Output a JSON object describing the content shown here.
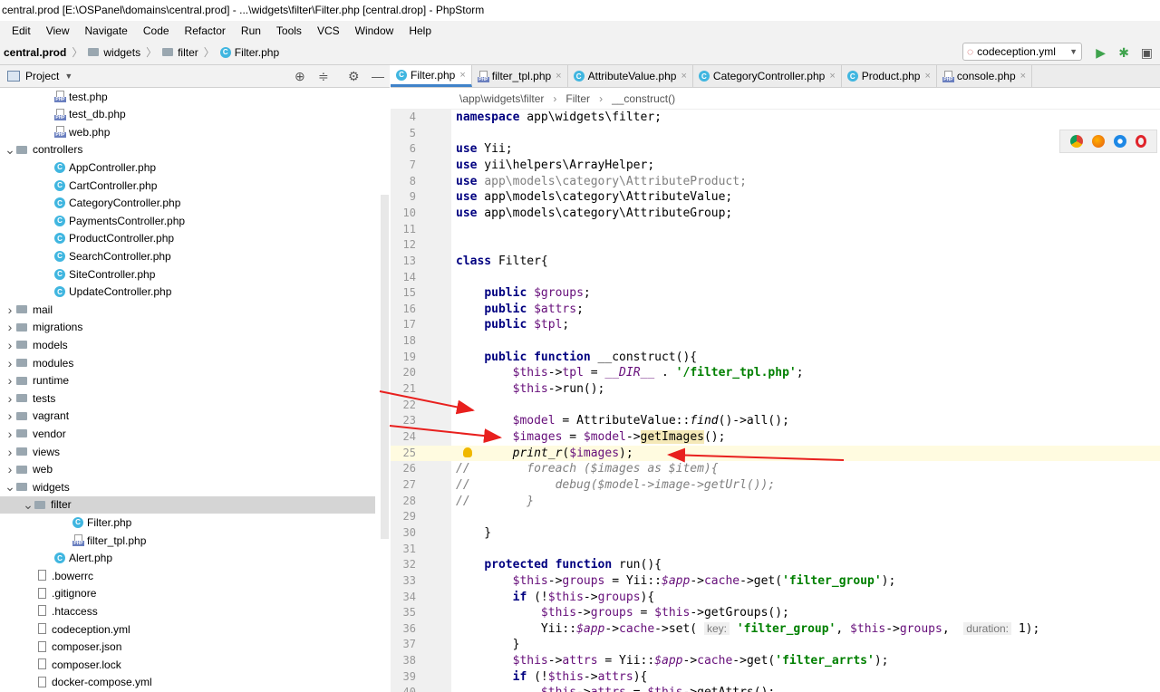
{
  "window": {
    "title": "central.prod [E:\\OSPanel\\domains\\central.prod] - ...\\widgets\\filter\\Filter.php [central.drop] - PhpStorm"
  },
  "menu": [
    "Edit",
    "View",
    "Navigate",
    "Code",
    "Refactor",
    "Run",
    "Tools",
    "VCS",
    "Window",
    "Help"
  ],
  "nav": {
    "project": "central.prod",
    "crumbs": [
      "widgets",
      "filter",
      "Filter.php"
    ],
    "run_config": "codeception.yml"
  },
  "project_panel": {
    "title": "Project"
  },
  "tree": [
    {
      "label": "test.php",
      "type": "php",
      "indent": 3
    },
    {
      "label": "test_db.php",
      "type": "php",
      "indent": 3
    },
    {
      "label": "web.php",
      "type": "php",
      "indent": 3
    },
    {
      "label": "controllers",
      "type": "folder",
      "indent": 1,
      "open": true
    },
    {
      "label": "AppController.php",
      "type": "class",
      "indent": 3
    },
    {
      "label": "CartController.php",
      "type": "class",
      "indent": 3
    },
    {
      "label": "CategoryController.php",
      "type": "class",
      "indent": 3
    },
    {
      "label": "PaymentsController.php",
      "type": "class",
      "indent": 3
    },
    {
      "label": "ProductController.php",
      "type": "class",
      "indent": 3
    },
    {
      "label": "SearchController.php",
      "type": "class",
      "indent": 3
    },
    {
      "label": "SiteController.php",
      "type": "class",
      "indent": 3
    },
    {
      "label": "UpdateController.php",
      "type": "class",
      "indent": 3
    },
    {
      "label": "mail",
      "type": "folder",
      "indent": 1
    },
    {
      "label": "migrations",
      "type": "folder",
      "indent": 1
    },
    {
      "label": "models",
      "type": "folder",
      "indent": 1
    },
    {
      "label": "modules",
      "type": "folder",
      "indent": 1
    },
    {
      "label": "runtime",
      "type": "folder",
      "indent": 1
    },
    {
      "label": "tests",
      "type": "folder",
      "indent": 1
    },
    {
      "label": "vagrant",
      "type": "folder",
      "indent": 1
    },
    {
      "label": "vendor",
      "type": "folder",
      "indent": 1
    },
    {
      "label": "views",
      "type": "folder",
      "indent": 1
    },
    {
      "label": "web",
      "type": "folder",
      "indent": 1
    },
    {
      "label": "widgets",
      "type": "folder",
      "indent": 1,
      "open": true
    },
    {
      "label": "filter",
      "type": "folder",
      "indent": 2,
      "open": true,
      "selected": true
    },
    {
      "label": "Filter.php",
      "type": "class",
      "indent": 4
    },
    {
      "label": "filter_tpl.php",
      "type": "php",
      "indent": 4
    },
    {
      "label": "Alert.php",
      "type": "class",
      "indent": 3
    },
    {
      "label": ".bowerrc",
      "type": "file",
      "indent": 2
    },
    {
      "label": ".gitignore",
      "type": "file",
      "indent": 2
    },
    {
      "label": ".htaccess",
      "type": "file",
      "indent": 2
    },
    {
      "label": "codeception.yml",
      "type": "file",
      "indent": 2
    },
    {
      "label": "composer.json",
      "type": "file",
      "indent": 2
    },
    {
      "label": "composer.lock",
      "type": "file",
      "indent": 2
    },
    {
      "label": "docker-compose.yml",
      "type": "file",
      "indent": 2
    }
  ],
  "tabs": [
    {
      "label": "Filter.php",
      "type": "class",
      "active": true
    },
    {
      "label": "filter_tpl.php",
      "type": "php"
    },
    {
      "label": "AttributeValue.php",
      "type": "class"
    },
    {
      "label": "CategoryController.php",
      "type": "class"
    },
    {
      "label": "Product.php",
      "type": "class"
    },
    {
      "label": "console.php",
      "type": "php"
    }
  ],
  "editor_breadcrumb": [
    "\\app\\widgets\\filter",
    "Filter",
    "__construct()"
  ],
  "code": [
    {
      "n": "4",
      "h": "<span class='k'>namespace</span> app\\widgets\\filter;"
    },
    {
      "n": "5",
      "h": ""
    },
    {
      "n": "6",
      "h": "<span class='k'>use</span> Yii;"
    },
    {
      "n": "7",
      "h": "<span class='k'>use</span> yii\\helpers\\ArrayHelper;"
    },
    {
      "n": "8",
      "h": "<span class='k'>use</span> <span class='g'>app\\models\\category\\AttributeProduct;</span>"
    },
    {
      "n": "9",
      "h": "<span class='k'>use</span> app\\models\\category\\AttributeValue;"
    },
    {
      "n": "10",
      "h": "<span class='k'>use</span> app\\models\\category\\AttributeGroup;"
    },
    {
      "n": "11",
      "h": ""
    },
    {
      "n": "12",
      "h": ""
    },
    {
      "n": "13",
      "h": "<span class='k'>class</span> Filter{"
    },
    {
      "n": "14",
      "h": ""
    },
    {
      "n": "15",
      "h": "    <span class='k'>public</span> <span class='v'>$groups</span>;"
    },
    {
      "n": "16",
      "h": "    <span class='k'>public</span> <span class='v'>$attrs</span>;"
    },
    {
      "n": "17",
      "h": "    <span class='k'>public</span> <span class='v'>$tpl</span>;"
    },
    {
      "n": "18",
      "h": ""
    },
    {
      "n": "19",
      "h": "    <span class='k'>public function</span> __construct(){"
    },
    {
      "n": "20",
      "h": "        <span class='v'>$this</span>-><span class='v'>tpl</span> = <span class='v i'>__DIR__</span> . <span class='s'>'/filter_tpl.php'</span>;"
    },
    {
      "n": "21",
      "h": "        <span class='v'>$this</span>->run();"
    },
    {
      "n": "22",
      "h": ""
    },
    {
      "n": "23",
      "h": "        <span class='v'>$model</span> = AttributeValue::<span class='i'>find</span>()->all();"
    },
    {
      "n": "24",
      "h": "        <span class='v'>$images</span> = <span class='v'>$model</span>-><span class='mark'>getImages</span>();"
    },
    {
      "n": "25",
      "h": "        <span class='i'>print_r</span>(<span class='v'>$images</span>);",
      "hl": true
    },
    {
      "n": "26",
      "h": "<span class='c'>//        foreach ($images as $item){</span>"
    },
    {
      "n": "27",
      "h": "<span class='c'>//            debug($model->image->getUrl());</span>"
    },
    {
      "n": "28",
      "h": "<span class='c'>//        }</span>"
    },
    {
      "n": "29",
      "h": ""
    },
    {
      "n": "30",
      "h": "    }"
    },
    {
      "n": "31",
      "h": ""
    },
    {
      "n": "32",
      "h": "    <span class='k'>protected function</span> run(){"
    },
    {
      "n": "33",
      "h": "        <span class='v'>$this</span>-><span class='v'>groups</span> = Yii::<span class='v i'>$app</span>-><span class='v'>cache</span>->get(<span class='s'>'filter_group'</span>);"
    },
    {
      "n": "34",
      "h": "        <span class='k'>if</span> (!<span class='v'>$this</span>-><span class='v'>groups</span>){"
    },
    {
      "n": "35",
      "h": "            <span class='v'>$this</span>-><span class='v'>groups</span> = <span class='v'>$this</span>->getGroups();"
    },
    {
      "n": "36",
      "h": "            Yii::<span class='v i'>$app</span>-><span class='v'>cache</span>->set( <span class='hint'>key:</span> <span class='s'>'filter_group'</span>, <span class='v'>$this</span>-><span class='v'>groups</span>,  <span class='hint'>duration:</span> 1);"
    },
    {
      "n": "37",
      "h": "        }"
    },
    {
      "n": "38",
      "h": "        <span class='v'>$this</span>-><span class='v'>attrs</span> = Yii::<span class='v i'>$app</span>-><span class='v'>cache</span>->get(<span class='s'>'filter_arrts'</span>);"
    },
    {
      "n": "39",
      "h": "        <span class='k'>if</span> (!<span class='v'>$this</span>-><span class='v'>attrs</span>){"
    },
    {
      "n": "40",
      "h": "            <span class='v'>$this</span>-><span class='v'>attrs</span> = <span class='v'>$this</span>->getAttrs();"
    }
  ],
  "colors": {
    "arrow": "#e8201e",
    "selection": "#d5d5d5",
    "tab_accent": "#4083c9"
  }
}
